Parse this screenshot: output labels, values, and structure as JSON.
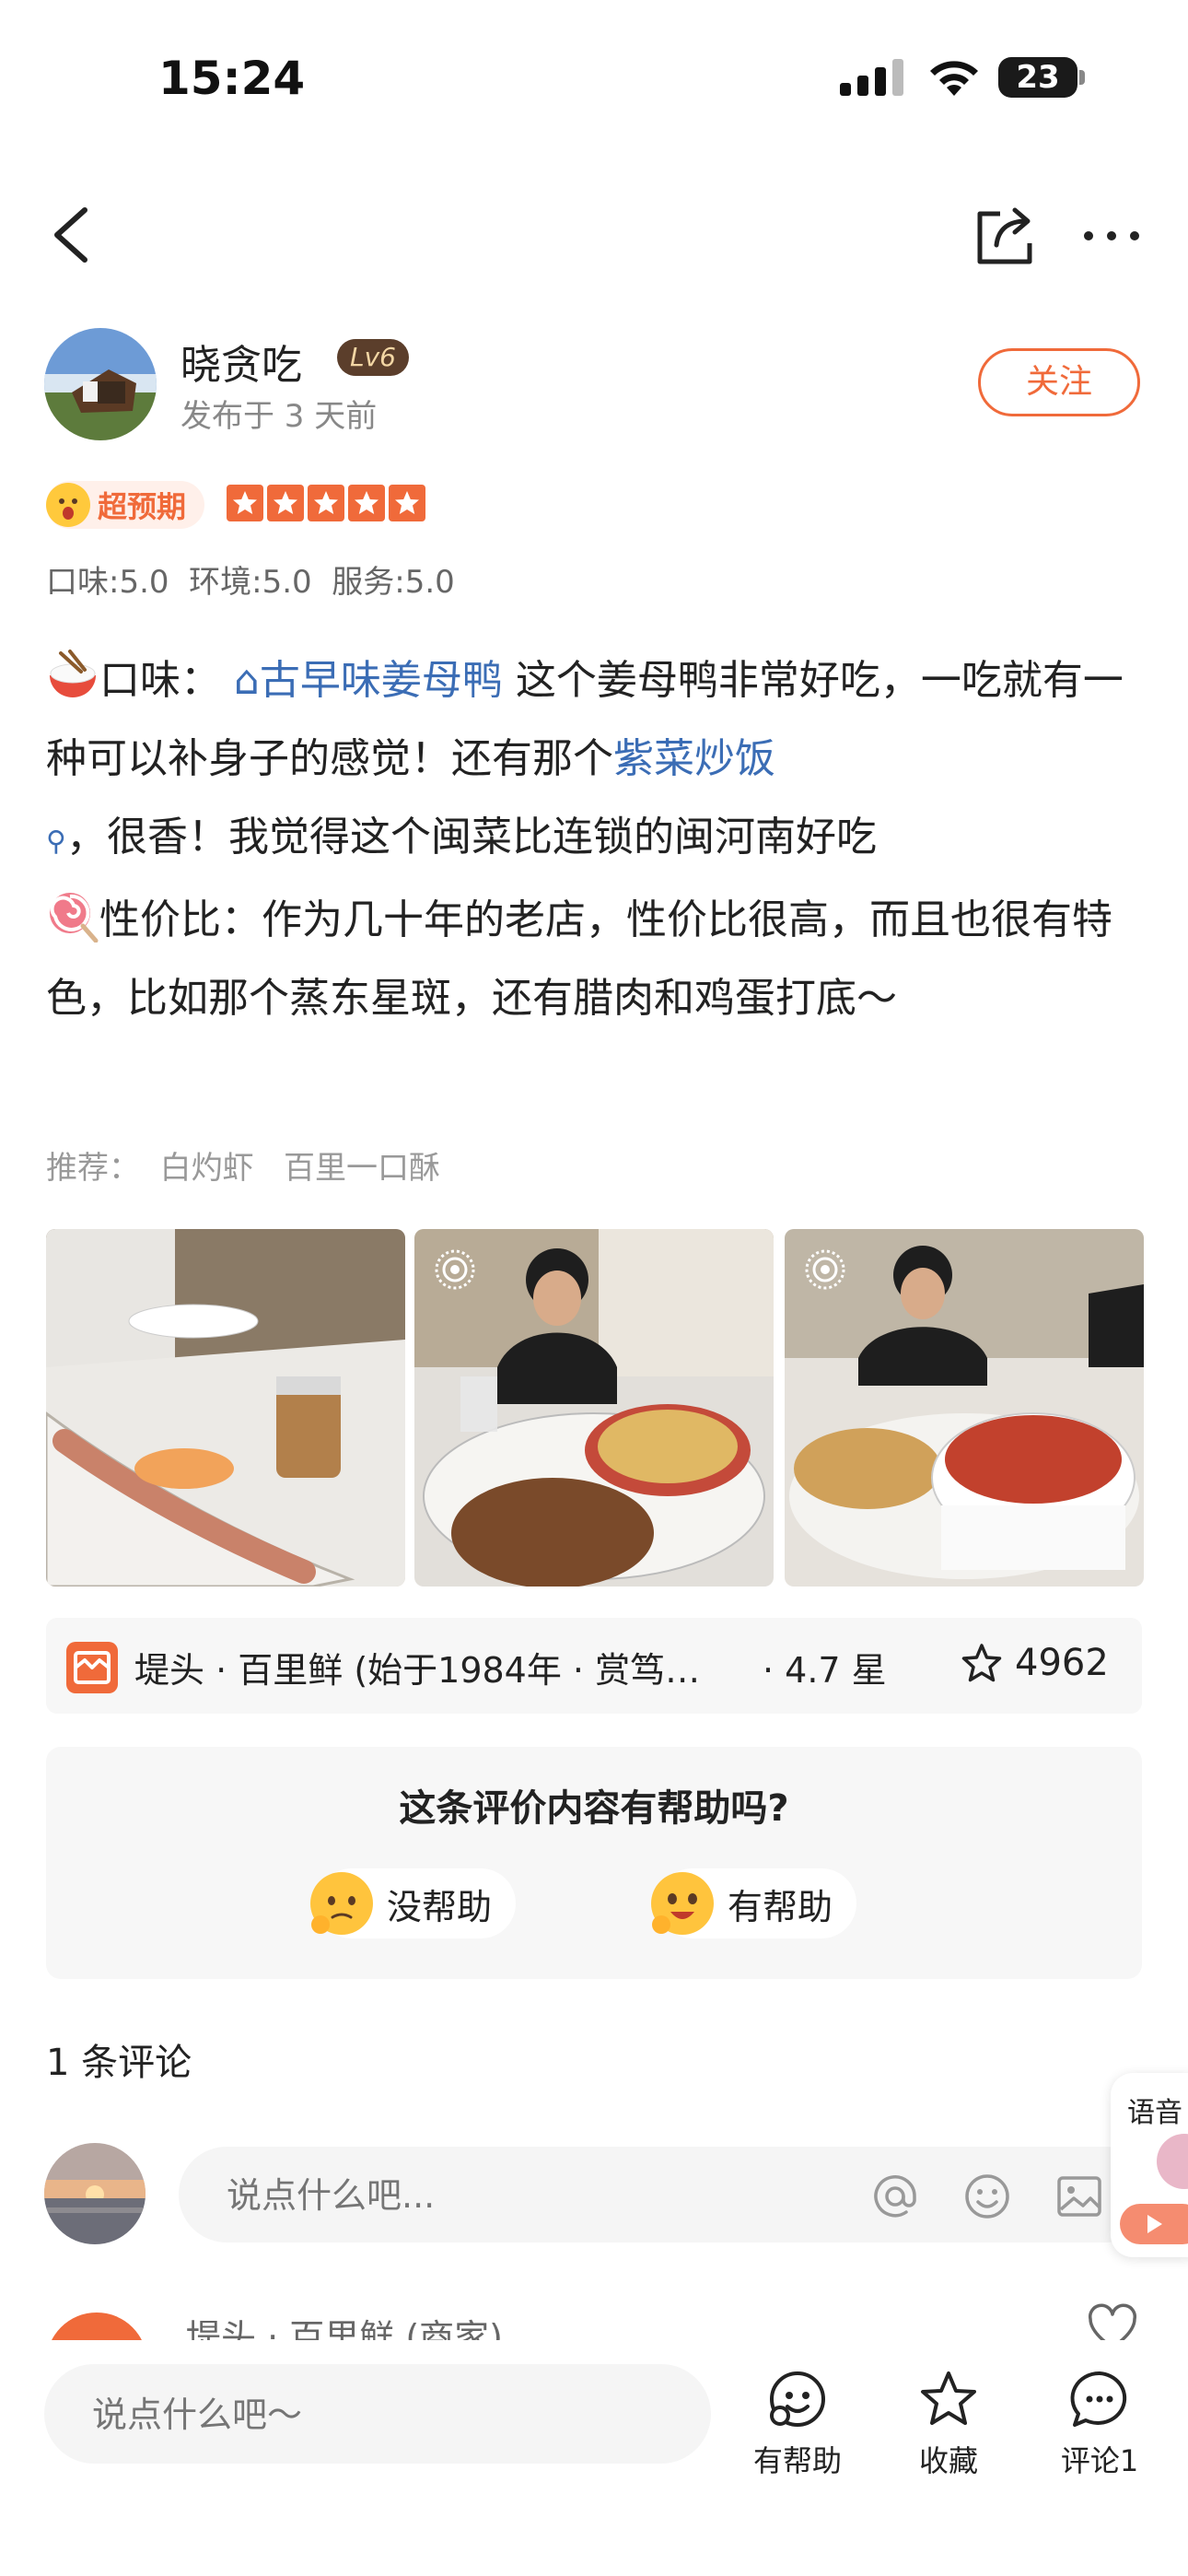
{
  "status_bar": {
    "time": "15:24",
    "battery": "23"
  },
  "nav": {
    "back_icon": "chevron-left-icon",
    "share_icon": "share-icon",
    "more_icon": "more-icon"
  },
  "author": {
    "name": "晓贪吃",
    "level": "Lv6",
    "posted": "发布于 3 天前",
    "follow_label": "关注"
  },
  "rating": {
    "badge": "超预期",
    "stars": 5,
    "scores": "口味:5.0  环境:5.0  服务:5.0"
  },
  "review": {
    "p1_label": "口味：",
    "p1_tag": "⌂古早味姜母鸭",
    "p1_text": " 这个姜母鸭非常好吃，一吃就有一种可以补身子的感觉！还有那个",
    "p1_tag2": "紫菜炒饭",
    "p1_search": "⚲",
    "p1_text2": "，很香！我觉得这个闽菜比连锁的闽河南好吃",
    "p2_label": "性价比：",
    "p2_text": "作为几十年的老店，性价比很高，而且也很有特色，比如那个蒸东星斑，还有腊肉和鸡蛋打底～"
  },
  "recommend": "推荐：  白灼虾   百里一口酥",
  "shop": {
    "name": "堤头 · 百里鲜 (始于1984年 · 赏笃…",
    "rating": "· 4.7 星",
    "favorites": "4962"
  },
  "helpful": {
    "question": "这条评价内容有帮助吗?",
    "no_label": "没帮助",
    "yes_label": "有帮助"
  },
  "comments": {
    "count_label": "1 条评论",
    "input_placeholder": "说点什么吧...",
    "merchant_name": "堤头 · 百里鲜 (商家)"
  },
  "voice_tab": {
    "label": "语音"
  },
  "bottom_bar": {
    "input_placeholder": "说点什么吧～",
    "helpful_label": "有帮助",
    "collect_label": "收藏",
    "comment_label": "评论1"
  }
}
